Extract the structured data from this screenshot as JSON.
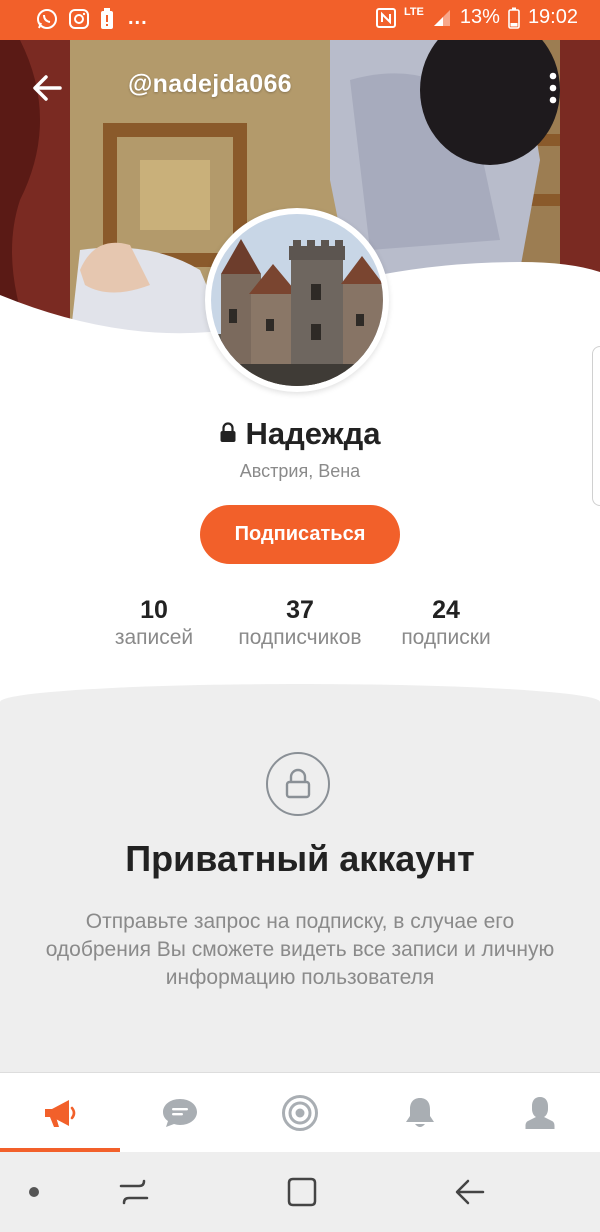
{
  "status_bar": {
    "icons_left": [
      "whatsapp-icon",
      "instagram-icon",
      "battery-alert-icon"
    ],
    "more": "...",
    "network": "LTE",
    "battery": "13%",
    "time": "19:02"
  },
  "header": {
    "username": "@nadejda066"
  },
  "profile": {
    "name": "Надежда",
    "location": "Австрия, Вена",
    "subscribe_label": "Подписаться",
    "stats": [
      {
        "value": "10",
        "label": "записей"
      },
      {
        "value": "37",
        "label": "подписчиков"
      },
      {
        "value": "24",
        "label": "подписки"
      }
    ]
  },
  "private": {
    "title": "Приватный аккаунт",
    "text": "Отправьте запрос на подписку, в случае его одобрения Вы сможете видеть все записи и личную информацию пользователя"
  },
  "tabbar": {
    "tabs": [
      "megaphone-icon",
      "chat-icon",
      "target-icon",
      "bell-icon",
      "person-icon"
    ],
    "active_index": 0
  },
  "colors": {
    "accent": "#f2602a",
    "text_dark": "#222222",
    "text_muted": "#8a8a8a",
    "icon_gray": "#8a9096"
  }
}
